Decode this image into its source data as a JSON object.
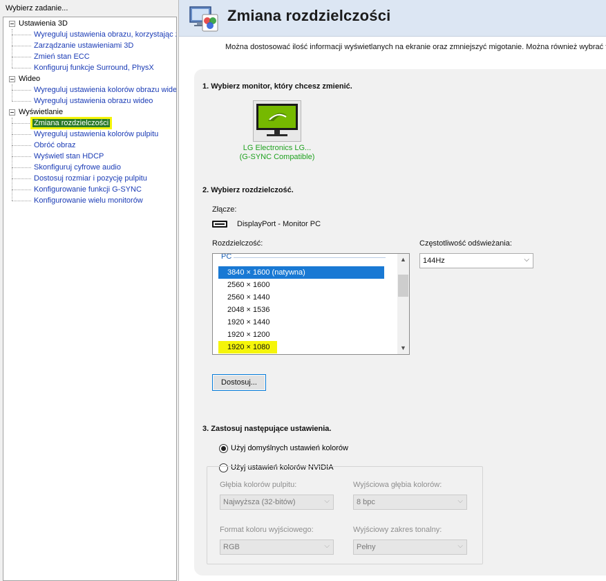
{
  "sidebar": {
    "header": "Wybierz zadanie...",
    "groups": [
      {
        "label": "Ustawienia 3D",
        "items": [
          "Wyreguluj ustawienia obrazu, korzystając z",
          "Zarządzanie ustawieniami 3D",
          "Zmień stan ECC",
          "Konfiguruj funkcje Surround, PhysX"
        ]
      },
      {
        "label": "Wideo",
        "items": [
          "Wyreguluj ustawienia kolorów obrazu wideo",
          "Wyreguluj ustawienia obrazu wideo"
        ]
      },
      {
        "label": "Wyświetlanie",
        "items": [
          "Zmiana rozdzielczości",
          "Wyreguluj ustawienia kolorów pulpitu",
          "Obróć obraz",
          "Wyświetl stan HDCP",
          "Skonfiguruj cyfrowe audio",
          "Dostosuj rozmiar i pozycję pulpitu",
          "Konfigurowanie funkcji G-SYNC",
          "Konfigurowanie wielu monitorów"
        ]
      }
    ],
    "selected_item": "Zmiana rozdzielczości"
  },
  "page": {
    "title": "Zmiana rozdzielczości",
    "description": "Można dostosować ilość informacji wyświetlanych na ekranie oraz zmniejszyć migotanie. Można również wybrać format"
  },
  "step1": {
    "title": "1. Wybierz monitor, który chcesz zmienić.",
    "monitor_name_line1": "LG Electronics LG...",
    "monitor_name_line2": "(G-SYNC Compatible)"
  },
  "step2": {
    "title": "2. Wybierz rozdzielczość.",
    "connector_label": "Złącze:",
    "connector_value": "DisplayPort - Monitor PC",
    "resolution_label": "Rozdzielczość:",
    "list_group": "PC",
    "resolutions": [
      "3840 × 1600 (natywna)",
      "2560 × 1600",
      "2560 × 1440",
      "2048 × 1536",
      "1920 × 1440",
      "1920 × 1200",
      "1920 × 1080"
    ],
    "selected_resolution": "3840 × 1600 (natywna)",
    "refresh_label": "Częstotliwość odświeżania:",
    "refresh_value": "144Hz",
    "customize_button": "Dostosuj..."
  },
  "step3": {
    "title": "3. Zastosuj następujące ustawienia.",
    "option_default": "Użyj domyślnych ustawień kolorów",
    "option_nvidia": "Użyj ustawień kolorów NVIDIA",
    "selected_option": "default",
    "desktop_depth_label": "Głębia kolorów pulpitu:",
    "desktop_depth_value": "Najwyższa (32-bitów)",
    "output_depth_label": "Wyjściowa głębia kolorów:",
    "output_depth_value": "8 bpc",
    "output_format_label": "Format koloru wyjściowego:",
    "output_format_value": "RGB",
    "output_range_label": "Wyjściowy zakres tonalny:",
    "output_range_value": "Pełny"
  },
  "colors": {
    "nvidia_green": "#76b900",
    "link_blue": "#1a3bb5",
    "selection_blue": "#1979d4",
    "highlight_yellow": "#f5f50a"
  }
}
